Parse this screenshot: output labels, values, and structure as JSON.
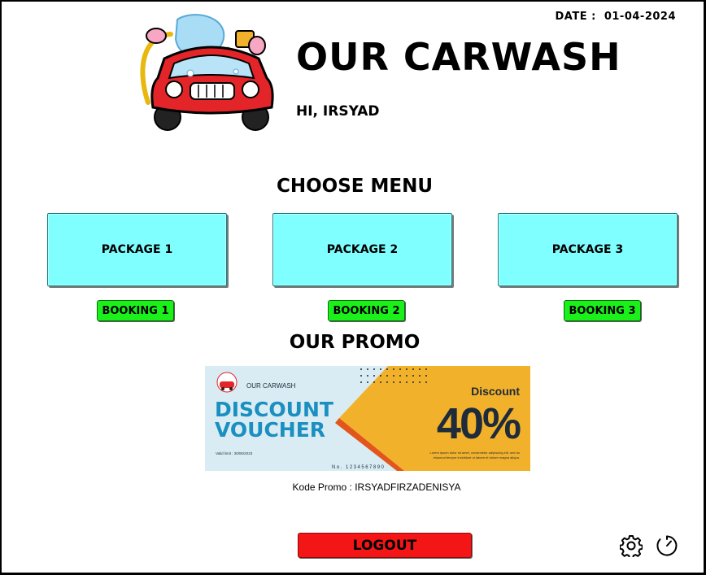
{
  "header": {
    "date_label": "DATE :",
    "date_value": "01-04-2024",
    "title": "OUR CARWASH",
    "greeting": "HI, IRSYAD"
  },
  "menu": {
    "title": "CHOOSE MENU",
    "packages": [
      {
        "label": "PACKAGE 1",
        "booking_label": "BOOKING 1"
      },
      {
        "label": "PACKAGE 2",
        "booking_label": "BOOKING 2"
      },
      {
        "label": "PACKAGE 3",
        "booking_label": "BOOKING 3"
      }
    ]
  },
  "promo": {
    "title": "OUR PROMO",
    "voucher": {
      "brand": "OUR CARWASH",
      "line1": "DISCOUNT",
      "line2": "VOUCHER",
      "valid": "Valid limit : 30/06/2023",
      "number": "No. 1234567890",
      "discount_label": "Discount",
      "discount_value": "40%",
      "fine_print_1": "Lorem ipsum dolor sit amet, consectetur adipiscing elit, sed do",
      "fine_print_2": "eiusmod tempor incididunt ut labore et dolore magna aliqua."
    },
    "code_text": "Kode Promo : IRSYADFIRZADENISYA"
  },
  "footer": {
    "logout_label": "LOGOUT",
    "settings_icon": "gear-icon",
    "history_icon": "clock-icon"
  },
  "colors": {
    "package_bg": "#7fffff",
    "booking_bg": "#1bf01b",
    "logout_bg": "#f41616",
    "voucher_blue": "#1a8fc0",
    "voucher_orange": "#f2b12a",
    "voucher_bg": "#d9ecf3"
  }
}
